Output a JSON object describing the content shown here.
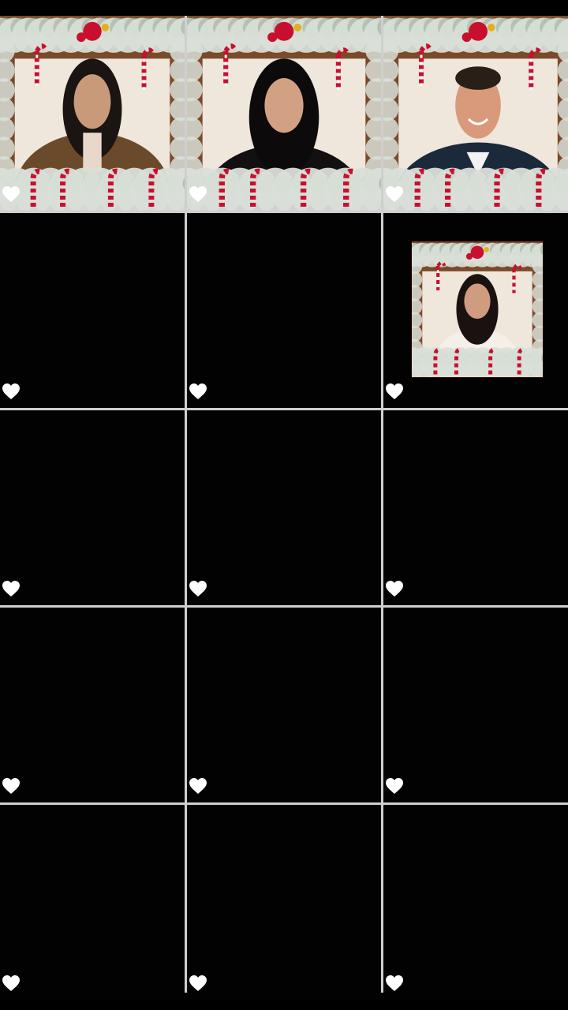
{
  "grid": {
    "columns": 3,
    "rows": 5,
    "cells": [
      {
        "id": "c1",
        "content": "photo",
        "subject": "woman-fur-coat",
        "liked": true
      },
      {
        "id": "c2",
        "content": "photo",
        "subject": "girl-black-hair",
        "liked": true
      },
      {
        "id": "c3",
        "content": "photo",
        "subject": "man-smiling",
        "liked": true
      },
      {
        "id": "c4",
        "content": "empty",
        "liked": true
      },
      {
        "id": "c5",
        "content": "empty",
        "liked": true
      },
      {
        "id": "c6",
        "content": "thumbnail",
        "subject": "girl-white-dress",
        "liked": true
      },
      {
        "id": "c7",
        "content": "empty",
        "liked": true
      },
      {
        "id": "c8",
        "content": "empty",
        "liked": true
      },
      {
        "id": "c9",
        "content": "empty",
        "liked": true
      },
      {
        "id": "c10",
        "content": "empty",
        "liked": true
      },
      {
        "id": "c11",
        "content": "empty",
        "liked": true
      },
      {
        "id": "c12",
        "content": "empty",
        "liked": true
      },
      {
        "id": "c13",
        "content": "empty",
        "liked": true
      },
      {
        "id": "c14",
        "content": "empty",
        "liked": true
      },
      {
        "id": "c15",
        "content": "empty",
        "liked": true
      }
    ]
  },
  "icons": {
    "like": "heart-icon"
  },
  "colors": {
    "background": "#000000",
    "grid_lines": "#cfcfcf",
    "heart": "#ffffff",
    "frame_wood": "#7a4a2a",
    "wall": "#efe6dc",
    "garland": "#d9dfd8",
    "candy_red": "#c8102e"
  }
}
